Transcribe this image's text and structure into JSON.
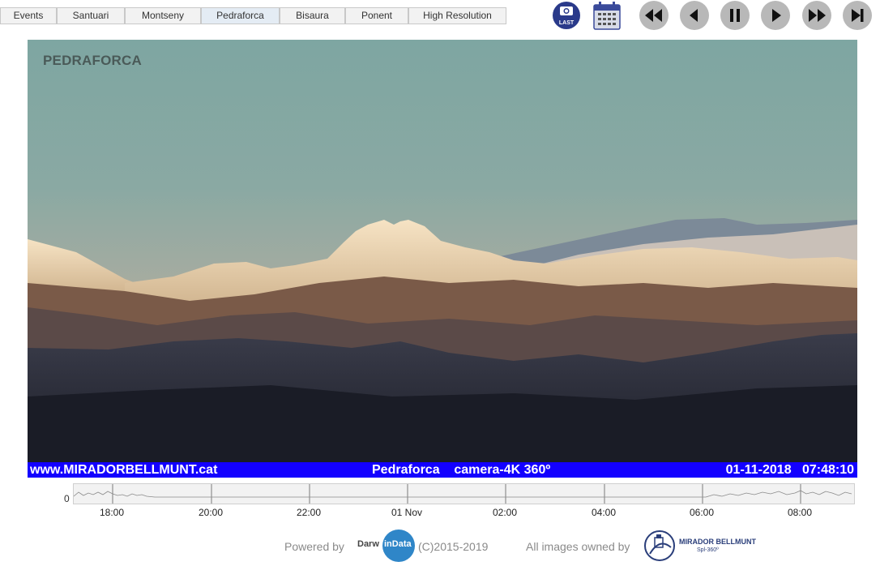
{
  "tabs": [
    {
      "label": "Events",
      "active": false
    },
    {
      "label": "Santuari",
      "active": false
    },
    {
      "label": "Montseny",
      "active": false
    },
    {
      "label": "Pedraforca",
      "active": true
    },
    {
      "label": "Bisaura",
      "active": false
    },
    {
      "label": "Ponent",
      "active": false
    },
    {
      "label": "High Resolution",
      "active": false
    }
  ],
  "toolbar": {
    "last_label": "LAST",
    "icons": [
      "camera-last-icon",
      "calendar-icon",
      "fast-rewind-icon",
      "step-back-icon",
      "pause-icon",
      "play-icon",
      "fast-forward-icon",
      "skip-end-icon"
    ],
    "accent": "#2a3a8a"
  },
  "viewer": {
    "camera_label": "PEDRAFORCA"
  },
  "caption": {
    "site": "www.MIRADORBELLMUNT.cat",
    "location": "Pedraforca",
    "camera": "camera-4K 360º",
    "date": "01-11-2018",
    "time": "07:48:10",
    "bar_color": "#1300ff"
  },
  "timeline": {
    "zero_label": "0",
    "ticks": [
      "18:00",
      "20:00",
      "22:00",
      "01 Nov",
      "02:00",
      "04:00",
      "06:00",
      "08:00"
    ]
  },
  "footer": {
    "powered_by": "Powered by",
    "darwin_part1": "Darw",
    "darwin_part2": "inData",
    "copyright": "(C)2015-2019",
    "owned_by": "All images owned by",
    "owner_name": "MIRADOR BELLMUNT",
    "owner_sub": "Spl-360º"
  }
}
